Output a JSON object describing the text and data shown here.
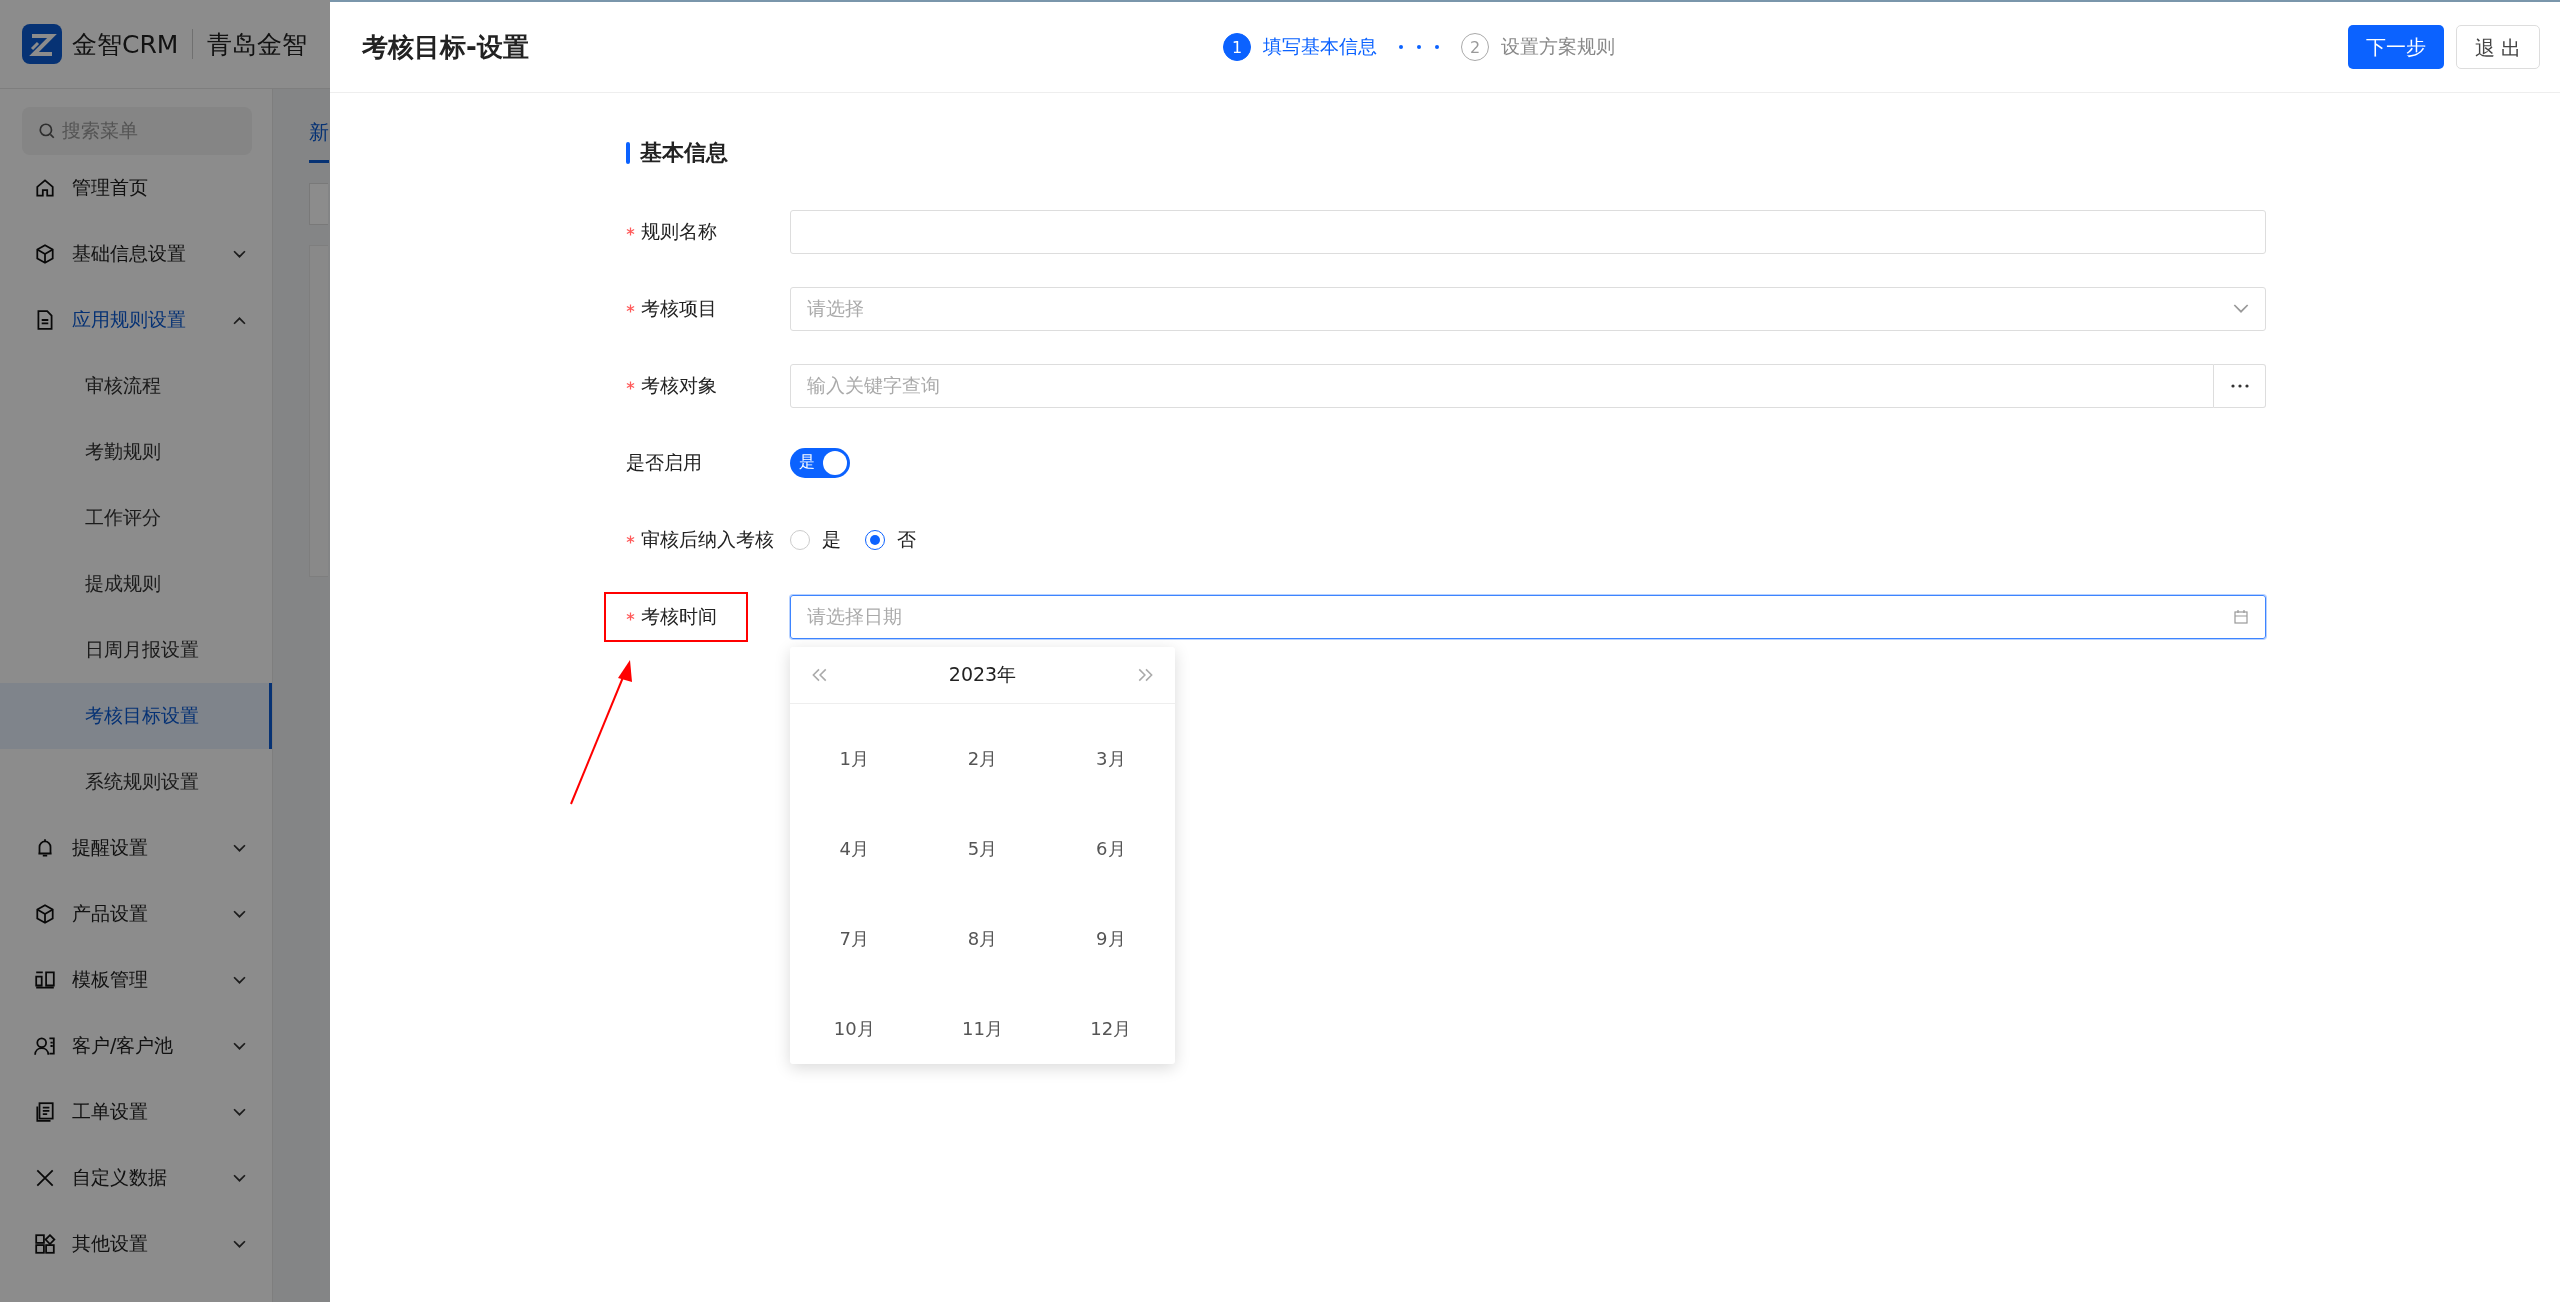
{
  "app": {
    "logo_text": "金智CRM",
    "company": "青岛金智"
  },
  "sidebar": {
    "search_placeholder": "搜索菜单",
    "items": [
      {
        "kind": "link",
        "label": "管理首页",
        "selected": false
      },
      {
        "kind": "group",
        "label": "基础信息设置",
        "expanded": false,
        "selected": false
      },
      {
        "kind": "group",
        "label": "应用规则设置",
        "expanded": true,
        "selected": true,
        "children": [
          {
            "label": "审核流程",
            "selected": false
          },
          {
            "label": "考勤规则",
            "selected": false
          },
          {
            "label": "工作评分",
            "selected": false
          },
          {
            "label": "提成规则",
            "selected": false
          },
          {
            "label": "日周月报设置",
            "selected": false
          },
          {
            "label": "考核目标设置",
            "selected": true
          },
          {
            "label": "系统规则设置",
            "selected": false
          }
        ]
      },
      {
        "kind": "group",
        "label": "提醒设置",
        "expanded": false,
        "selected": false
      },
      {
        "kind": "group",
        "label": "产品设置",
        "expanded": false,
        "selected": false
      },
      {
        "kind": "group",
        "label": "模板管理",
        "expanded": false,
        "selected": false
      },
      {
        "kind": "group",
        "label": "客户/客户池",
        "expanded": false,
        "selected": false
      },
      {
        "kind": "group",
        "label": "工单设置",
        "expanded": false,
        "selected": false
      },
      {
        "kind": "group",
        "label": "自定义数据",
        "expanded": false,
        "selected": false
      },
      {
        "kind": "group",
        "label": "其他设置",
        "expanded": false,
        "selected": false
      }
    ]
  },
  "main": {
    "tabs": [
      {
        "label": "新",
        "selected": true
      }
    ]
  },
  "drawer": {
    "title": "考核目标-设置",
    "steps": [
      {
        "number": "1",
        "label": "填写基本信息",
        "selected": true
      },
      {
        "number": "2",
        "label": "设置方案规则",
        "selected": false
      }
    ],
    "buttons": [
      {
        "kind": "primary",
        "label": "下一步"
      },
      {
        "kind": "default",
        "label": "退 出"
      }
    ],
    "section_title": "基本信息",
    "fields": [
      {
        "kind": "text",
        "label": "规则名称",
        "required": true,
        "annotated": false
      },
      {
        "kind": "select",
        "label": "考核项目",
        "required": true,
        "placeholder": "请选择",
        "annotated": false
      },
      {
        "kind": "lookup",
        "label": "考核对象",
        "required": true,
        "placeholder": "输入关键字查询",
        "annotated": false
      },
      {
        "kind": "switch",
        "label": "是否启用",
        "required": false,
        "on": true,
        "on_text": "是",
        "annotated": false
      },
      {
        "kind": "radio",
        "label": "审核后纳入考核",
        "required": true,
        "annotated": false,
        "options": [
          {
            "label": "是",
            "selected": false
          },
          {
            "label": "否",
            "selected": true
          }
        ]
      },
      {
        "kind": "date",
        "label": "考核时间",
        "required": true,
        "placeholder": "请选择日期",
        "focused": true,
        "annotated": true
      }
    ],
    "month_picker": {
      "year": "2023年",
      "months": [
        "1月",
        "2月",
        "3月",
        "4月",
        "5月",
        "6月",
        "7月",
        "8月",
        "9月",
        "10月",
        "11月",
        "12月"
      ]
    }
  }
}
